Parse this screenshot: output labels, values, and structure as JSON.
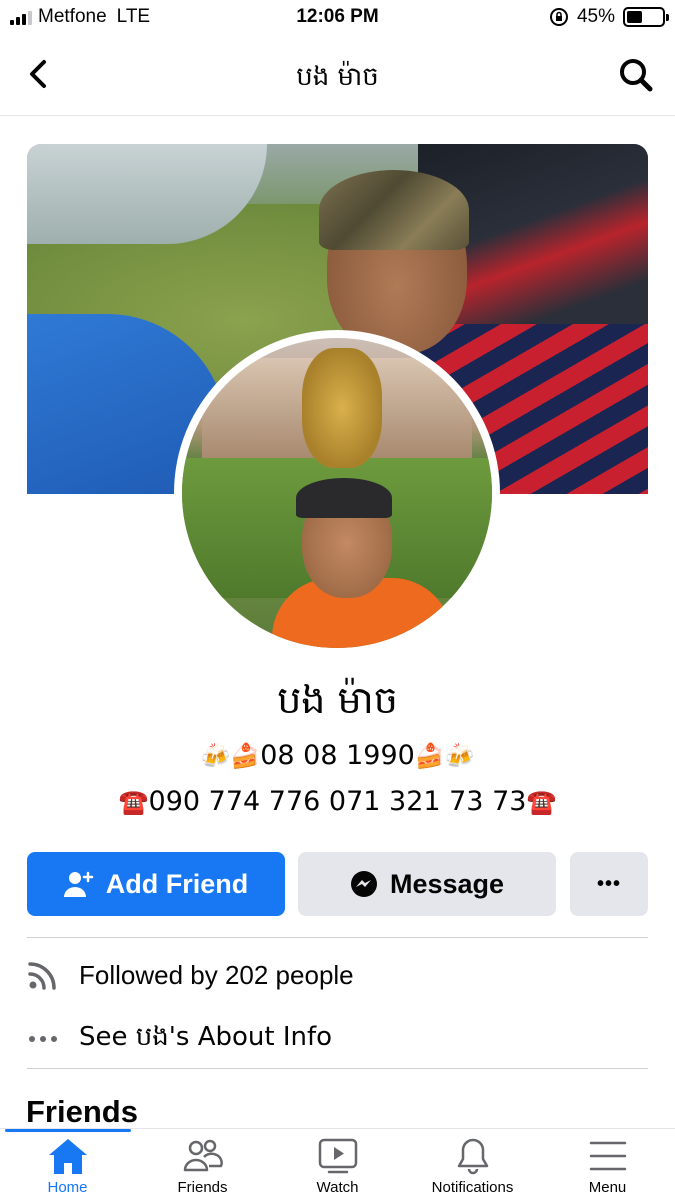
{
  "status_bar": {
    "carrier": "Metfone",
    "network": "LTE",
    "time": "12:06 PM",
    "battery_percent": "45%",
    "battery_level": 0.45
  },
  "header": {
    "title": "បង ម៉ាច",
    "back_icon": "chevron-left-icon",
    "search_icon": "search-icon"
  },
  "profile": {
    "name": "បង ម៉ាច",
    "bio_line_1": "08 08 1990",
    "bio_line_2": "090 774 776 071 321 73 73",
    "bio_emoji_left_1": "🍻🍰",
    "bio_emoji_right_1": "🍰🍻",
    "bio_emoji_phone": "☎️"
  },
  "actions": {
    "add_friend": "Add Friend",
    "message": "Message",
    "more": "•••"
  },
  "info": {
    "followed_by": "Followed by 202 people",
    "about": "See បង's About Info"
  },
  "sections": {
    "friends": "Friends"
  },
  "tabbar": {
    "items": [
      {
        "label": "Home",
        "icon": "home-icon",
        "active": true
      },
      {
        "label": "Friends",
        "icon": "friends-icon",
        "active": false
      },
      {
        "label": "Watch",
        "icon": "watch-icon",
        "active": false
      },
      {
        "label": "Notifications",
        "icon": "bell-icon",
        "active": false
      },
      {
        "label": "Menu",
        "icon": "menu-icon",
        "active": false
      }
    ]
  },
  "colors": {
    "primary": "#1877f2",
    "secondary_button": "#e4e6eb",
    "text": "#050505"
  }
}
